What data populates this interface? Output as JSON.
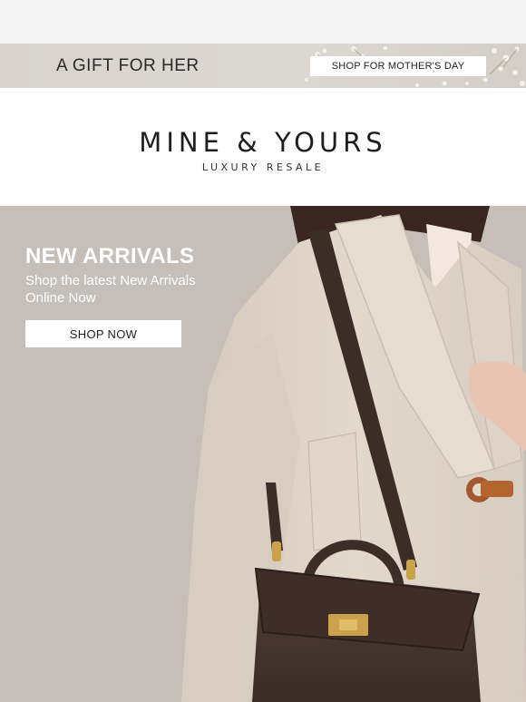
{
  "promo": {
    "title": "A GIFT FOR HER",
    "button_label": "SHOP FOR MOTHER'S DAY"
  },
  "brand": {
    "name": "MINE & YOURS",
    "tagline": "LUXURY RESALE"
  },
  "hero": {
    "title": "NEW ARRIVALS",
    "subtitle": "Shop the latest New Arrivals Online Now",
    "button_label": "SHOP NOW"
  },
  "colors": {
    "background": "#f4f4f4",
    "promo_bg": "#d8d3cd",
    "hero_bg": "#c6bfb9",
    "coat": "#ddd3c6",
    "bag": "#4a362c",
    "hardware": "#c9a24a"
  }
}
